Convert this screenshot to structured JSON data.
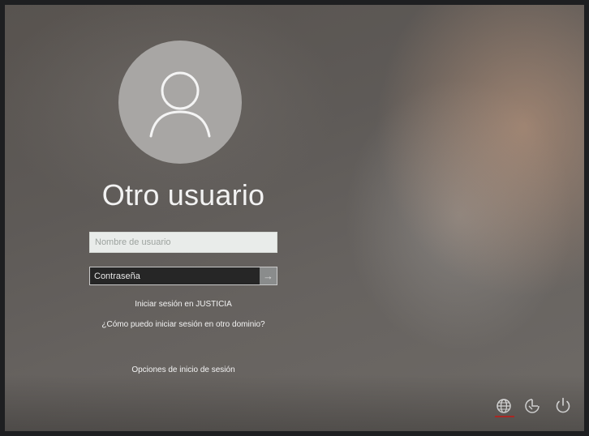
{
  "login": {
    "title": "Otro usuario",
    "username_placeholder": "Nombre de usuario",
    "password_placeholder": "Contraseña",
    "submit_glyph": "→",
    "signin_domain_link": "Iniciar sesión en JUSTICIA",
    "other_domain_link": "¿Cómo puedo iniciar sesión en otro dominio?",
    "signin_options_link": "Opciones de inicio de sesión"
  },
  "tray": {
    "icons": [
      "network-icon",
      "ease-of-access-icon",
      "power-icon"
    ]
  },
  "colors": {
    "accent_underline": "#d0302b",
    "avatar_bg": "#a8a6a4"
  }
}
